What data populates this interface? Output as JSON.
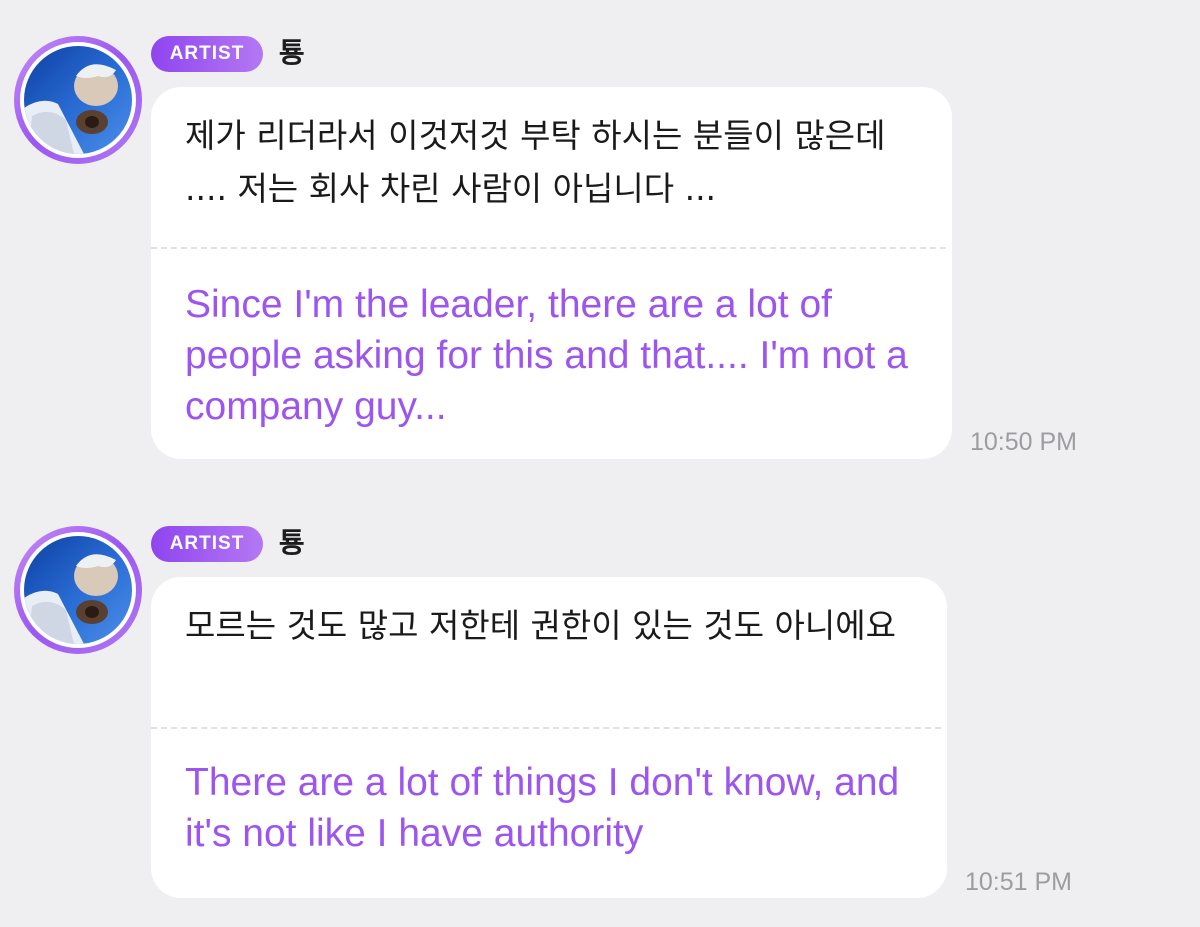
{
  "messages": [
    {
      "badge": "ARTIST",
      "username": "툥",
      "original_text": "제가 리더라서 이것저것 부탁 하시는 분들이 많은데 .... 저는 회사 차린 사람이 아닙니다 ...",
      "translation_text": "Since I'm the leader, there are a lot of people asking for this and that.... I'm not a company guy...",
      "time": "10:50 PM"
    },
    {
      "badge": "ARTIST",
      "username": "툥",
      "original_text": "모르는 것도 많고 저한테 권한이 있는 것도 아니에요",
      "translation_text": "There are a lot of things I don't know, and it's not like I have authority",
      "time": "10:51 PM"
    }
  ],
  "colors": {
    "background": "#efeff1",
    "bubble": "#ffffff",
    "accent_purple": "#9d55ef",
    "badge_gradient_start": "#8f45ef",
    "badge_gradient_end": "#b478f3",
    "timestamp": "#9c9ca2"
  },
  "icons": {
    "avatar": "profile-photo"
  }
}
